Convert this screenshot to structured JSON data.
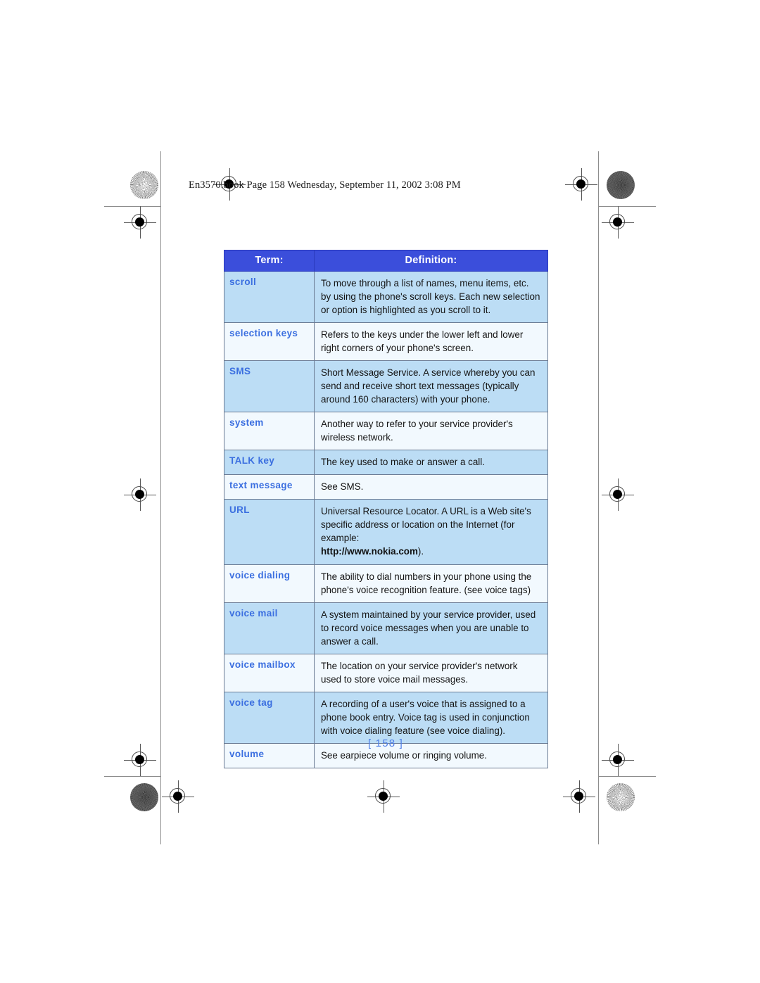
{
  "page_header": "En3570.book  Page 158  Wednesday, September 11, 2002  3:08 PM",
  "page_number": "[ 158 ]",
  "colors": {
    "header_blue": "#3b4edb",
    "term_blue": "#3b6fe0",
    "row_shade": "#bcddf5",
    "row_plain": "#f2f9fe",
    "page_number_blue": "#4f7fe8",
    "border": "#6a7a93"
  },
  "table": {
    "headers": {
      "term": "Term:",
      "definition": "Definition:"
    },
    "rows": [
      {
        "term": "scroll",
        "definition": "To move through a list of names, menu items, etc. by using the phone's scroll keys. Each new selection or option is highlighted as you scroll to it.",
        "shaded": true
      },
      {
        "term": "selection keys",
        "definition": "Refers to the keys under the lower left and lower right corners of your phone's screen.",
        "shaded": false
      },
      {
        "term": "SMS",
        "definition": "Short Message Service. A service whereby you can send and receive short text messages (typically around 160 characters) with your phone.",
        "shaded": true
      },
      {
        "term": "system",
        "definition": "Another way to refer to your service provider's wireless network.",
        "shaded": false
      },
      {
        "term": "TALK key",
        "definition": "The key used to make or answer a call.",
        "shaded": true
      },
      {
        "term": "text message",
        "definition": "See SMS.",
        "shaded": false
      },
      {
        "term": "URL",
        "definition": "Universal Resource Locator. A URL is a Web site's specific address or location on the Internet (for example:",
        "definition_url": "http://www.nokia.com",
        "definition_suffix": ").",
        "shaded": true
      },
      {
        "term": "voice dialing",
        "definition": "The ability to dial numbers in your phone using the phone's voice recognition feature.  (see voice tags)",
        "shaded": false
      },
      {
        "term": "voice mail",
        "definition": "A system maintained by your service provider, used to record voice messages when you are unable to answer a call.",
        "shaded": true
      },
      {
        "term": "voice mailbox",
        "definition": "The location on your service provider's network used to store voice mail messages.",
        "shaded": false
      },
      {
        "term": "voice tag",
        "definition": "A recording of a user's voice that is assigned to a phone book entry. Voice tag is used in conjunction with voice dialing feature (see voice dialing).",
        "shaded": true
      },
      {
        "term": "volume",
        "definition": "See earpiece volume or ringing volume.",
        "shaded": false
      }
    ]
  }
}
